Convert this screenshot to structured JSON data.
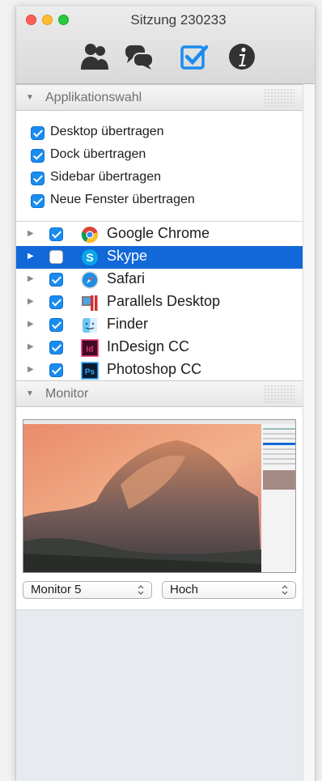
{
  "window": {
    "title": "Sitzung 230233"
  },
  "toolbar": {
    "icons": [
      "users-icon",
      "chat-icon",
      "checklist-icon",
      "info-icon"
    ],
    "accent": "#1a8cf0"
  },
  "applikationswahl": {
    "title": "Applikationswahl",
    "options": [
      {
        "label": "Desktop übertragen",
        "checked": true
      },
      {
        "label": "Dock übertragen",
        "checked": true
      },
      {
        "label": "Sidebar übertragen",
        "checked": true
      },
      {
        "label": "Neue Fenster übertragen",
        "checked": true
      }
    ],
    "apps": [
      {
        "name": "Google Chrome",
        "checked": true,
        "selected": false,
        "icon": "chrome-icon"
      },
      {
        "name": "Skype",
        "checked": false,
        "selected": true,
        "icon": "skype-icon"
      },
      {
        "name": "Safari",
        "checked": true,
        "selected": false,
        "icon": "safari-icon"
      },
      {
        "name": "Parallels Desktop",
        "checked": true,
        "selected": false,
        "icon": "parallels-icon"
      },
      {
        "name": "Finder",
        "checked": true,
        "selected": false,
        "icon": "finder-icon"
      },
      {
        "name": "InDesign CC",
        "checked": true,
        "selected": false,
        "icon": "indesign-icon"
      },
      {
        "name": "Photoshop CC",
        "checked": true,
        "selected": false,
        "icon": "photoshop-icon"
      }
    ]
  },
  "monitor": {
    "title": "Monitor",
    "monitor_select": "Monitor 5",
    "quality_select": "Hoch"
  },
  "colors": {
    "selection": "#1168d8"
  }
}
